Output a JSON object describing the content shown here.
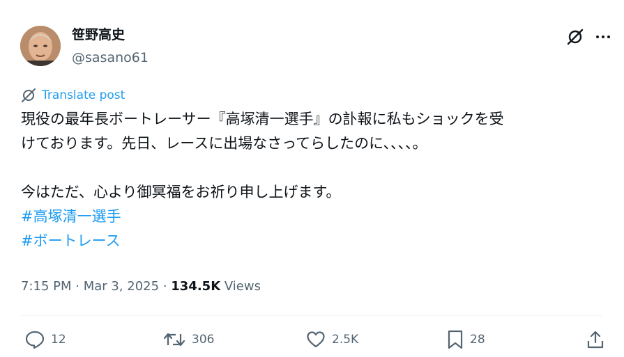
{
  "author": {
    "display_name": "笹野高史",
    "handle": "@sasano61"
  },
  "translate": {
    "label": "Translate post"
  },
  "tweet": {
    "line1": "現役の最年長ボートレーサー『高塚清一選手』の訃報に私もショックを受",
    "line2": "けております。先日、レースに出場なさってらしたのに、、、、。",
    "line3": "今はただ、心より御冥福をお祈り申し上げます。",
    "hashtags": [
      "#高塚清一選手",
      "#ボートレース"
    ]
  },
  "meta": {
    "time": "7:15 PM",
    "separator": " · ",
    "date": "Mar 3, 2025",
    "views_count": "134.5K",
    "views_label": " Views"
  },
  "actions": {
    "replies": "12",
    "reposts": "306",
    "likes": "2.5K",
    "bookmarks": "28"
  },
  "colors": {
    "text": "#0f1419",
    "secondary": "#536471",
    "link": "#1d9bf0"
  },
  "icons": [
    "grok-icon",
    "more-icon",
    "translate-icon",
    "reply-icon",
    "repost-icon",
    "like-icon",
    "bookmark-icon",
    "share-icon"
  ]
}
